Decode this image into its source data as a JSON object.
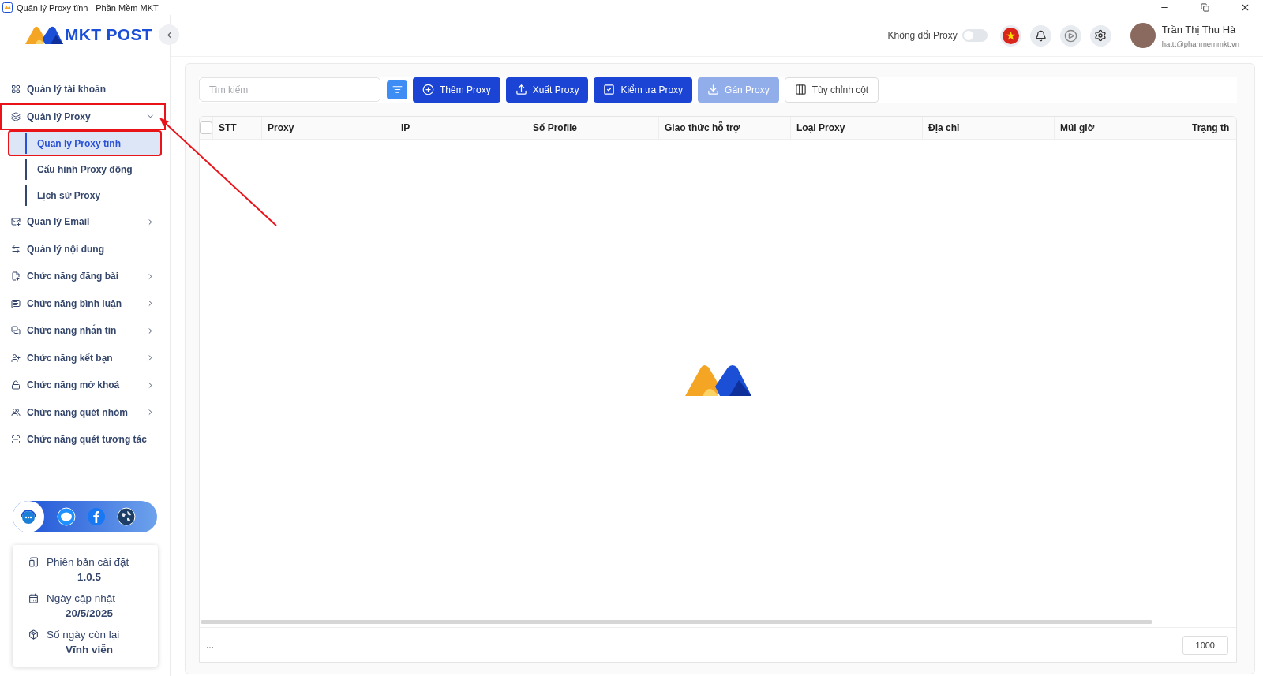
{
  "window": {
    "title": "Quản lý Proxy tĩnh - Phần Mềm MKT"
  },
  "logo": {
    "text": "MKT POST"
  },
  "sidebar": {
    "items": [
      {
        "label": "Quản lý tài khoản",
        "kind": "link"
      },
      {
        "label": "Quản lý Proxy",
        "kind": "group",
        "expanded": true,
        "annotated": true,
        "children": [
          {
            "label": "Quản lý Proxy tĩnh",
            "selected": true,
            "annotated": true
          },
          {
            "label": "Cấu hình Proxy động",
            "selected": false,
            "annotated": false
          },
          {
            "label": "Lịch sử Proxy",
            "selected": false,
            "annotated": false
          }
        ]
      },
      {
        "label": "Quản lý Email",
        "kind": "group",
        "expanded": false,
        "annotated": false
      },
      {
        "label": "Quản lý nội dung",
        "kind": "link"
      },
      {
        "label": "Chức năng đăng bài",
        "kind": "group",
        "expanded": false,
        "annotated": false
      },
      {
        "label": "Chức năng bình luận",
        "kind": "group",
        "expanded": false,
        "annotated": false
      },
      {
        "label": "Chức năng nhắn tin",
        "kind": "group",
        "expanded": false,
        "annotated": false
      },
      {
        "label": "Chức năng kết bạn",
        "kind": "group",
        "expanded": false,
        "annotated": false
      },
      {
        "label": "Chức năng mở khoá",
        "kind": "group",
        "expanded": false,
        "annotated": false
      },
      {
        "label": "Chức năng quét nhóm",
        "kind": "group",
        "expanded": false,
        "annotated": false
      },
      {
        "label": "Chức năng quét tương tác",
        "kind": "link"
      }
    ]
  },
  "info": [
    {
      "label": "Phiên bản cài đặt",
      "value": "1.0.5"
    },
    {
      "label": "Ngày cập nhật",
      "value": "20/5/2025"
    },
    {
      "label": "Số ngày còn lại",
      "value": "Vĩnh viễn"
    }
  ],
  "header": {
    "toggle": {
      "label": "Không đổi Proxy",
      "on": false
    },
    "user": {
      "name": "Trần Thị Thu Hà",
      "email": "hattt@phanmemmkt.vn"
    }
  },
  "search": {
    "placeholder": "Tìm kiếm"
  },
  "toolbar": [
    {
      "label": "Thêm Proxy",
      "kind": "primary",
      "disabled": false
    },
    {
      "label": "Xuất Proxy",
      "kind": "primary",
      "disabled": false
    },
    {
      "label": "Kiểm tra Proxy",
      "kind": "primary",
      "disabled": false
    },
    {
      "label": "Gán Proxy",
      "kind": "primary",
      "disabled": true
    },
    {
      "label": "Tùy chỉnh cột",
      "kind": "outline",
      "disabled": false
    }
  ],
  "table": {
    "select_all": {
      "checked": false
    },
    "columns": [
      "STT",
      "Proxy",
      "IP",
      "Số Profile",
      "Giao thức hỗ trợ",
      "Loại Proxy",
      "Địa chỉ",
      "Múi giờ",
      "Trạng th"
    ]
  },
  "footer": {
    "summary": "...",
    "page_size": "1000"
  }
}
